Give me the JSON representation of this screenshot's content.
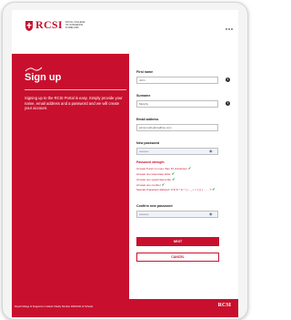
{
  "header": {
    "logo_main": "RCSI",
    "logo_sub": "ROYAL COLLEGE OF SURGEONS IN IRELAND"
  },
  "left": {
    "title": "Sign up",
    "description": "Signing up to the RCSI Portal is easy. Simply provide your name, email address and a password and we will create your account."
  },
  "form": {
    "first_name_label": "First name",
    "first_name_value": "John",
    "surname_label": "Surname",
    "surname_value": "Murphy",
    "email_label": "Email address",
    "email_value": "johnmurphy@mailbox.com",
    "new_password_label": "New password",
    "new_password_value": "••••••••••",
    "strength_title": "Password strength",
    "requirements": [
      {
        "text": "At least 8 and no more than 16 characters",
        "met": true
      },
      {
        "text": "At least one lowercase letter",
        "met": true
      },
      {
        "text": "At least one uppercase letter",
        "met": true
      },
      {
        "text": "At least one number",
        "met": true
      },
      {
        "text": "Special characters allowed ! # $ % ^ & * ( ) - _ + = [ ] { } : ; , . ?",
        "met": true
      }
    ],
    "confirm_password_label": "Confirm new password",
    "confirm_password_value": "••••••••••",
    "next_label": "NEXT",
    "cancel_label": "CANCEL"
  },
  "footer": {
    "text": "Royal College of Surgeons in Ireland Charity Number 20001431 of Schools"
  },
  "colors": {
    "brand_red": "#c8102e",
    "check_green": "#2e9e3a"
  },
  "icons": [
    "crest-icon",
    "help-icon",
    "eye-icon",
    "check-icon"
  ]
}
